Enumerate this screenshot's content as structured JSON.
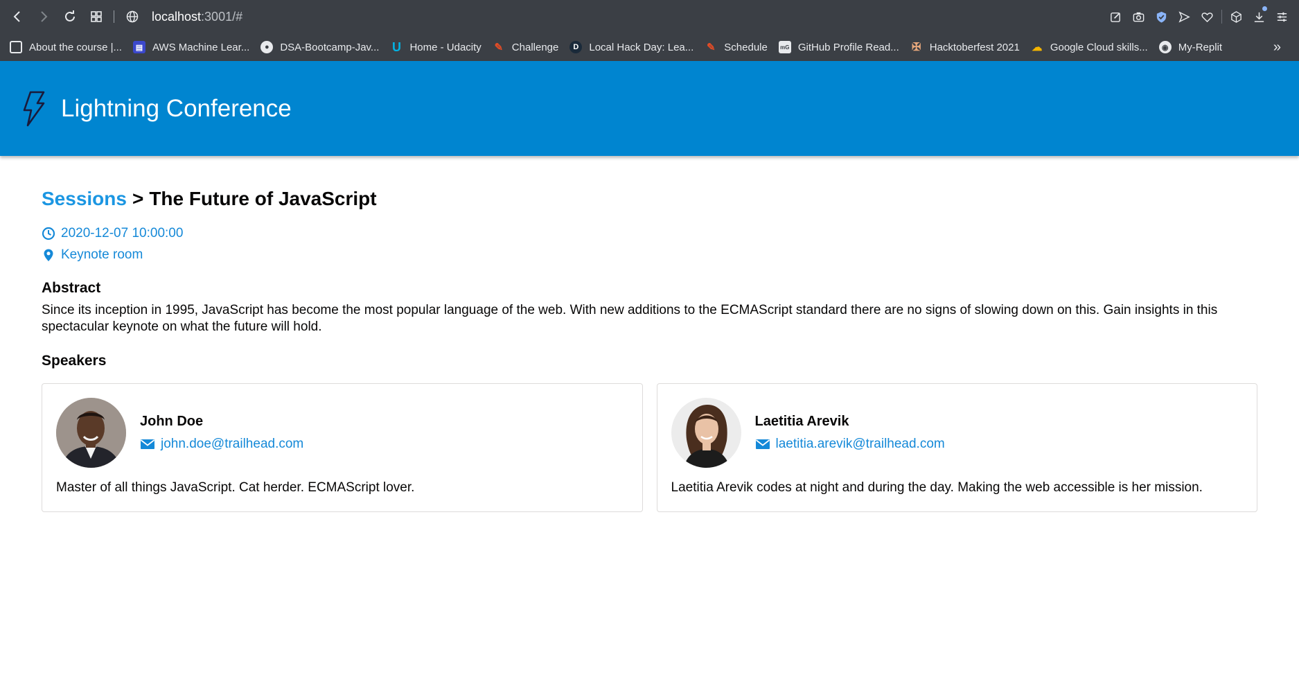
{
  "browser": {
    "url_host": "localhost",
    "url_path": ":3001/#",
    "bookmarks": [
      {
        "label": "About the course |...",
        "icon": "page-icon"
      },
      {
        "label": "AWS Machine Lear...",
        "icon": "aws-icon"
      },
      {
        "label": "DSA-Bootcamp-Jav...",
        "icon": "github-icon"
      },
      {
        "label": "Home - Udacity",
        "icon": "udacity-icon"
      },
      {
        "label": "Challenge",
        "icon": "pencil-icon"
      },
      {
        "label": "Local Hack Day: Lea...",
        "icon": "d-icon"
      },
      {
        "label": "Schedule",
        "icon": "pencil-icon"
      },
      {
        "label": "GitHub Profile Read...",
        "icon": "mg-icon"
      },
      {
        "label": "Hacktoberfest 2021",
        "icon": "hacktoberfest-icon"
      },
      {
        "label": "Google Cloud skills...",
        "icon": "google-cloud-icon"
      },
      {
        "label": "My-Replit",
        "icon": "replit-icon"
      }
    ],
    "more_label": "»"
  },
  "app": {
    "title": "Lightning Conference",
    "brand_color": "#0085d0"
  },
  "session": {
    "breadcrumb_link": "Sessions",
    "breadcrumb_sep": ">",
    "title": "The Future of JavaScript",
    "datetime": "2020-12-07 10:00:00",
    "room": "Keynote room",
    "abstract_heading": "Abstract",
    "abstract": "Since its inception in 1995, JavaScript has become the most popular language of the web. With new additions to the ECMAScript standard there are no signs of slowing down on this. Gain insights in this spectacular keynote on what the future will hold.",
    "speakers_heading": "Speakers"
  },
  "speakers": [
    {
      "name": "John Doe",
      "email": "john.doe@trailhead.com",
      "bio": "Master of all things JavaScript. Cat herder. ECMAScript lover."
    },
    {
      "name": "Laetitia Arevik",
      "email": "laetitia.arevik@trailhead.com",
      "bio": "Laetitia Arevik codes at night and during the day. Making the web accessible is her mission."
    }
  ]
}
